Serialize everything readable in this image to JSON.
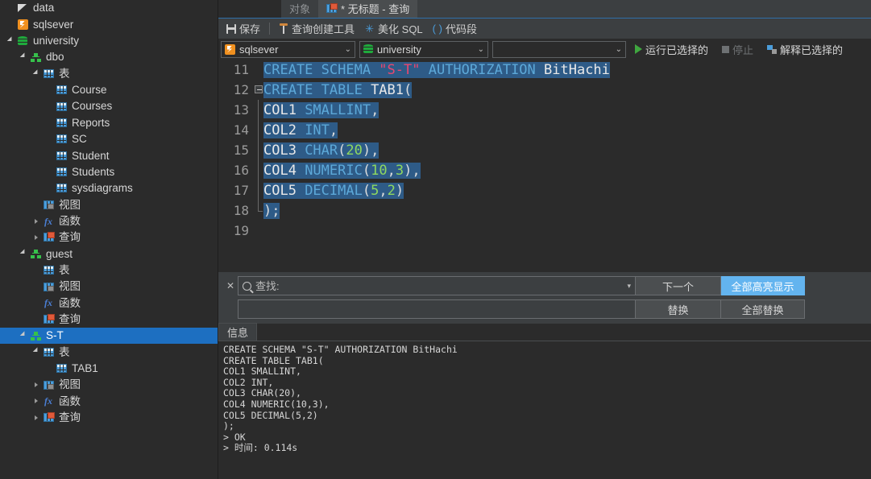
{
  "sidebar": {
    "items": [
      {
        "label": "data",
        "icon": "data-icon",
        "indent": 0,
        "arrow": "none",
        "selected": false
      },
      {
        "label": "sqlsever",
        "icon": "server-icon",
        "indent": 0,
        "arrow": "none",
        "selected": false
      },
      {
        "label": "university",
        "icon": "database-icon",
        "indent": 0,
        "arrow": "open",
        "selected": false
      },
      {
        "label": "dbo",
        "icon": "schema-icon",
        "indent": 1,
        "arrow": "open",
        "selected": false
      },
      {
        "label": "表",
        "icon": "table-icon",
        "indent": 2,
        "arrow": "open",
        "selected": false
      },
      {
        "label": "Course",
        "icon": "table-icon",
        "indent": 3,
        "arrow": "none",
        "selected": false
      },
      {
        "label": "Courses",
        "icon": "table-icon",
        "indent": 3,
        "arrow": "none",
        "selected": false
      },
      {
        "label": "Reports",
        "icon": "table-icon",
        "indent": 3,
        "arrow": "none",
        "selected": false
      },
      {
        "label": "SC",
        "icon": "table-icon",
        "indent": 3,
        "arrow": "none",
        "selected": false
      },
      {
        "label": "Student",
        "icon": "table-icon",
        "indent": 3,
        "arrow": "none",
        "selected": false
      },
      {
        "label": "Students",
        "icon": "table-icon",
        "indent": 3,
        "arrow": "none",
        "selected": false
      },
      {
        "label": "sysdiagrams",
        "icon": "table-icon",
        "indent": 3,
        "arrow": "none",
        "selected": false
      },
      {
        "label": "视图",
        "icon": "view-icon",
        "indent": 2,
        "arrow": "none",
        "selected": false
      },
      {
        "label": "函数",
        "icon": "function-icon",
        "indent": 2,
        "arrow": "closed",
        "selected": false
      },
      {
        "label": "查询",
        "icon": "query-icon",
        "indent": 2,
        "arrow": "closed",
        "selected": false
      },
      {
        "label": "guest",
        "icon": "schema-icon",
        "indent": 1,
        "arrow": "open",
        "selected": false
      },
      {
        "label": "表",
        "icon": "table-icon",
        "indent": 2,
        "arrow": "none",
        "selected": false
      },
      {
        "label": "视图",
        "icon": "view-icon",
        "indent": 2,
        "arrow": "none",
        "selected": false
      },
      {
        "label": "函数",
        "icon": "function-icon",
        "indent": 2,
        "arrow": "none",
        "selected": false
      },
      {
        "label": "查询",
        "icon": "query-icon",
        "indent": 2,
        "arrow": "none",
        "selected": false
      },
      {
        "label": "S-T",
        "icon": "schema-icon",
        "indent": 1,
        "arrow": "open",
        "selected": true
      },
      {
        "label": "表",
        "icon": "table-icon",
        "indent": 2,
        "arrow": "open",
        "selected": false
      },
      {
        "label": "TAB1",
        "icon": "table-icon",
        "indent": 3,
        "arrow": "none",
        "selected": false
      },
      {
        "label": "视图",
        "icon": "view-icon",
        "indent": 2,
        "arrow": "closed",
        "selected": false
      },
      {
        "label": "函数",
        "icon": "function-icon",
        "indent": 2,
        "arrow": "closed",
        "selected": false
      },
      {
        "label": "查询",
        "icon": "query-icon",
        "indent": 2,
        "arrow": "closed",
        "selected": false
      }
    ]
  },
  "tabs": [
    {
      "label": "对象",
      "icon": "",
      "active": false
    },
    {
      "label": "* 无标题 - 查询",
      "icon": "query-icon",
      "active": true
    }
  ],
  "toolbar": {
    "save_label": "保存",
    "query_builder_label": "查询创建工具",
    "beautify_label": "美化 SQL",
    "snippet_label": "代码段",
    "snippet_icon_text": "( )"
  },
  "connection": {
    "server": "sqlsever",
    "database": "university",
    "schema": "",
    "run_label": "运行已选择的",
    "stop_label": "停止",
    "explain_label": "解释已选择的"
  },
  "editor": {
    "lines": [
      {
        "no": "11",
        "fold": "none",
        "tokens": [
          {
            "t": "CREATE SCHEMA ",
            "c": "kw",
            "h": true
          },
          {
            "t": "\"S-T\"",
            "c": "str",
            "h": true
          },
          {
            "t": " AUTHORIZATION ",
            "c": "kw",
            "h": true
          },
          {
            "t": "BitHachi",
            "c": "id",
            "h": true
          }
        ]
      },
      {
        "no": "12",
        "fold": "box",
        "tokens": [
          {
            "t": "CREATE TABLE ",
            "c": "kw",
            "h": true
          },
          {
            "t": "TAB1",
            "c": "id",
            "h": true
          },
          {
            "t": "(",
            "c": "punct",
            "h": true
          }
        ]
      },
      {
        "no": "13",
        "fold": "bar",
        "tokens": [
          {
            "t": "COL1 ",
            "c": "id",
            "h": true
          },
          {
            "t": "SMALLINT",
            "c": "kw",
            "h": true
          },
          {
            "t": ",",
            "c": "punct",
            "h": true
          }
        ]
      },
      {
        "no": "14",
        "fold": "bar",
        "tokens": [
          {
            "t": "COL2 ",
            "c": "id",
            "h": true
          },
          {
            "t": "INT",
            "c": "kw",
            "h": true
          },
          {
            "t": ",",
            "c": "punct",
            "h": true
          }
        ]
      },
      {
        "no": "15",
        "fold": "bar",
        "tokens": [
          {
            "t": "COL3 ",
            "c": "id",
            "h": true
          },
          {
            "t": "CHAR",
            "c": "kw",
            "h": true
          },
          {
            "t": "(",
            "c": "punct",
            "h": true
          },
          {
            "t": "20",
            "c": "num",
            "h": true
          },
          {
            "t": "),",
            "c": "punct",
            "h": true
          }
        ]
      },
      {
        "no": "16",
        "fold": "bar",
        "tokens": [
          {
            "t": "COL4 ",
            "c": "id",
            "h": true
          },
          {
            "t": "NUMERIC",
            "c": "kw",
            "h": true
          },
          {
            "t": "(",
            "c": "punct",
            "h": true
          },
          {
            "t": "10",
            "c": "num",
            "h": true
          },
          {
            "t": ",",
            "c": "punct",
            "h": true
          },
          {
            "t": "3",
            "c": "num",
            "h": true
          },
          {
            "t": "),",
            "c": "punct",
            "h": true
          }
        ]
      },
      {
        "no": "17",
        "fold": "bar",
        "tokens": [
          {
            "t": "COL5 ",
            "c": "id",
            "h": true
          },
          {
            "t": "DECIMAL",
            "c": "kw",
            "h": true
          },
          {
            "t": "(",
            "c": "punct",
            "h": true
          },
          {
            "t": "5",
            "c": "num",
            "h": true
          },
          {
            "t": ",",
            "c": "punct",
            "h": true
          },
          {
            "t": "2",
            "c": "num",
            "h": true
          },
          {
            "t": ")",
            "c": "punct",
            "h": true
          }
        ]
      },
      {
        "no": "18",
        "fold": "end",
        "tokens": [
          {
            "t": ");",
            "c": "punct",
            "h": true
          }
        ]
      },
      {
        "no": "19",
        "fold": "none",
        "tokens": []
      }
    ]
  },
  "find": {
    "placeholder": "查找:",
    "value": "",
    "replace_value": "",
    "next_label": "下一个",
    "highlight_all_label": "全部高亮显示",
    "replace_label": "替换",
    "replace_all_label": "全部替换",
    "close_label": "✕"
  },
  "results": {
    "tab_label": "信息",
    "log": "CREATE SCHEMA \"S-T\" AUTHORIZATION BitHachi\nCREATE TABLE TAB1(\nCOL1 SMALLINT,\nCOL2 INT,\nCOL3 CHAR(20),\nCOL4 NUMERIC(10,3),\nCOL5 DECIMAL(5,2)\n);\n> OK\n> 时间: 0.114s"
  },
  "colors": {
    "background": "#2b2b2b",
    "panel": "#3c3f41",
    "selection": "#2e5b87",
    "tree_selected": "#1d6fc1",
    "accent_blue": "#63b4ef",
    "keyword": "#5ca8d8",
    "number": "#8fd860",
    "string": "#e8476f",
    "run_green": "#3fa63f"
  }
}
